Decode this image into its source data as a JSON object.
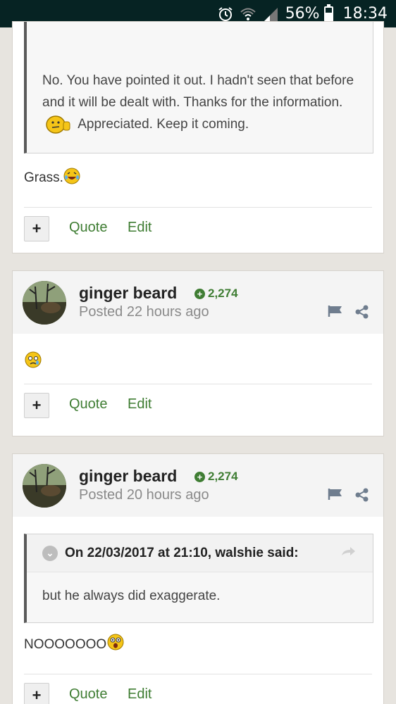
{
  "status_bar": {
    "battery": "56%",
    "time": "18:34",
    "battery_level": 0.56,
    "icons": [
      "alarm-icon",
      "wifi-icon",
      "signal-icon",
      "battery-icon"
    ]
  },
  "post1": {
    "quote_text": "No. You have pointed it out. I hadn't seen that before and it will be dealt with. Thanks for the information.",
    "quote_text_after": "Appreciated. Keep it coming.",
    "reply_text": "Grass.",
    "actions": {
      "quote": "Quote",
      "edit": "Edit"
    }
  },
  "post2": {
    "author": "ginger beard",
    "reputation": "2,274",
    "posted": "Posted 22 hours ago",
    "actions": {
      "quote": "Quote",
      "edit": "Edit"
    }
  },
  "post3": {
    "author": "ginger beard",
    "reputation": "2,274",
    "posted": "Posted 20 hours ago",
    "quote_header": "On 22/03/2017 at 21:10, walshie said:",
    "quote_text": "but he always did exaggerate.",
    "reply_text": "NOOOOOOO",
    "actions": {
      "quote": "Quote",
      "edit": "Edit"
    }
  },
  "colors": {
    "accent_green": "#3f7d33",
    "status_bar": "#062323",
    "background": "#e7e4df"
  }
}
